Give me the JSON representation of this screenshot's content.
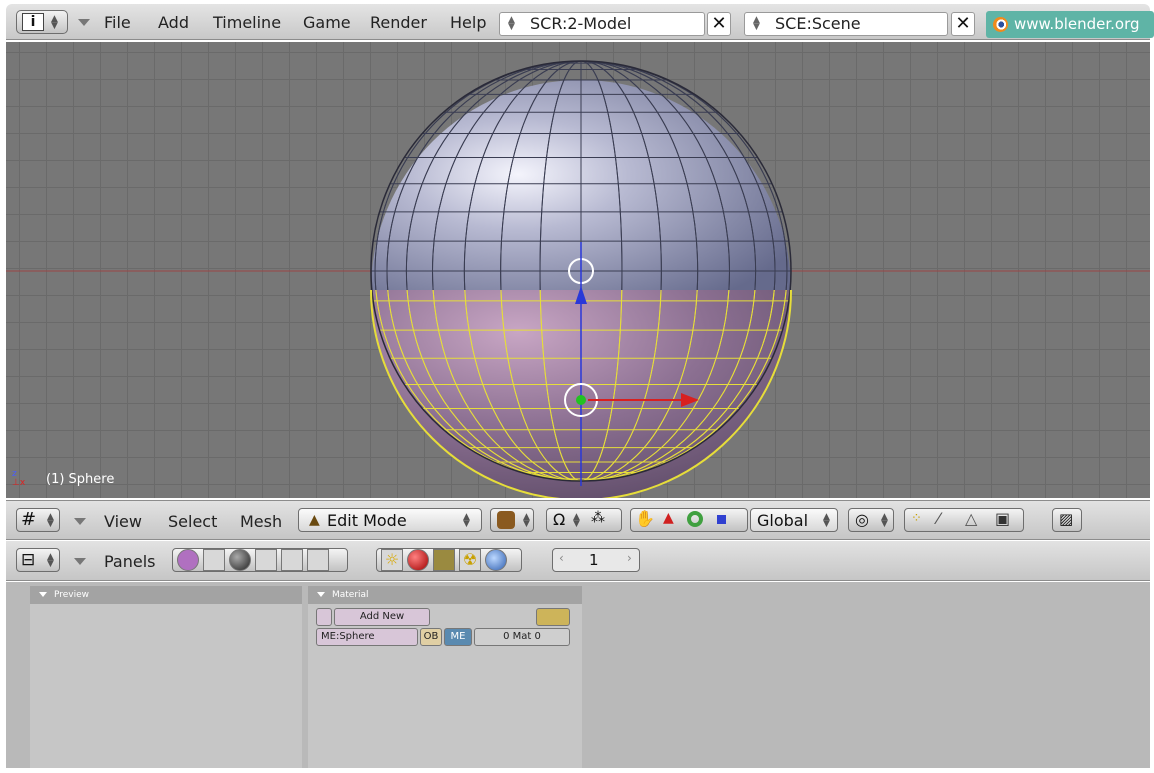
{
  "header": {
    "menu": [
      "File",
      "Add",
      "Timeline",
      "Game",
      "Render",
      "Help"
    ],
    "screen": "SCR:2-Model",
    "scene": "SCE:Scene",
    "website": "www.blender.org"
  },
  "viewport": {
    "object_label": "(1) Sphere",
    "axis_z": "z",
    "axis_x": "x"
  },
  "view3d_header": {
    "menus": [
      "View",
      "Select",
      "Mesh"
    ],
    "mode": "Edit Mode",
    "orientation": "Global"
  },
  "buttons_header": {
    "panels_label": "Panels",
    "frame": "1"
  },
  "panels": {
    "preview_title": "Preview",
    "material_title": "Material",
    "add_new": "Add New",
    "mesh_name": "ME:Sphere",
    "ob_label": "OB",
    "me_label": "ME",
    "mat_count": "0 Mat 0"
  },
  "colors": {
    "viewport_bg": "#777777",
    "selection": "#f0e442",
    "website_bg": "#5fb4a6"
  }
}
